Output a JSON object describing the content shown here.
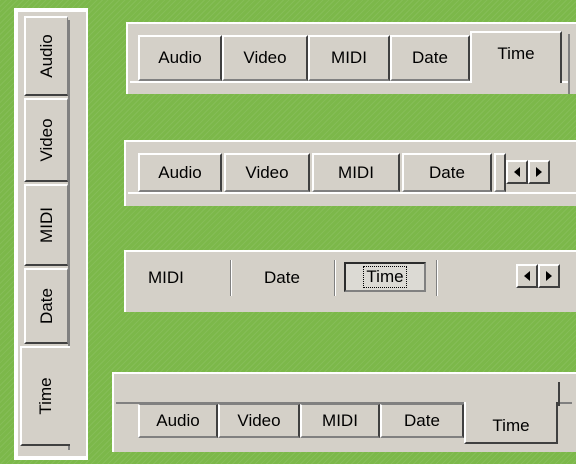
{
  "vertical_tabs": {
    "tabs": [
      "Audio",
      "Video",
      "MIDI",
      "Date",
      "Time"
    ],
    "selected": "Time"
  },
  "tabs_top": {
    "tabs": [
      "Audio",
      "Video",
      "MIDI",
      "Date",
      "Time"
    ],
    "selected": "Time"
  },
  "tabs_scroll": {
    "tabs": [
      "Audio",
      "Video",
      "MIDI",
      "Date"
    ],
    "scroll_left_icon": "arrow-left-icon",
    "scroll_right_icon": "arrow-right-icon"
  },
  "tabs_flat": {
    "tabs": [
      "MIDI",
      "Date",
      "Time"
    ],
    "selected": "Time",
    "scroll_left_icon": "arrow-left-icon",
    "scroll_right_icon": "arrow-right-icon"
  },
  "tabs_bottom": {
    "tabs": [
      "Audio",
      "Video",
      "MIDI",
      "Date",
      "Time"
    ],
    "selected": "Time"
  },
  "colors": {
    "background": "#7cb84a",
    "control_face": "#d4d0c8",
    "highlight": "#ffffff",
    "shadow": "#808080",
    "dark_shadow": "#404040"
  }
}
